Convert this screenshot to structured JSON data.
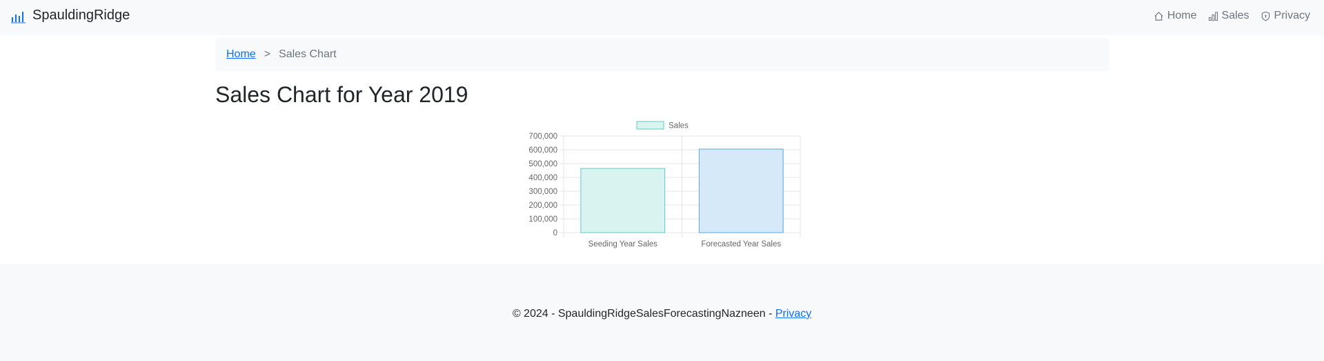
{
  "app": {
    "brand": "SpauldingRidge",
    "brand_icon": "bar-chart-icon"
  },
  "nav": {
    "items": [
      {
        "label": "Home",
        "icon": "home-icon"
      },
      {
        "label": "Sales",
        "icon": "bar-chart-icon"
      },
      {
        "label": "Privacy",
        "icon": "shield-icon"
      }
    ]
  },
  "breadcrumb": {
    "home": "Home",
    "separator": ">",
    "current": "Sales Chart"
  },
  "page": {
    "title": "Sales Chart for Year 2019"
  },
  "chart_data": {
    "type": "bar",
    "categories": [
      "Seeding Year Sales",
      "Forecasted Year Sales"
    ],
    "series": [
      {
        "name": "Sales",
        "values": [
          465000,
          605000
        ]
      }
    ],
    "bar_fill_colors": [
      "#d9f3f1",
      "#d6e9f8"
    ],
    "bar_stroke_colors": [
      "#5fc9c4",
      "#5aa6dd"
    ],
    "legend_fill": "#d9f3f1",
    "legend_stroke": "#5fc9c4",
    "ylim": [
      0,
      700000
    ],
    "yticks": [
      "700,000",
      "600,000",
      "500,000",
      "400,000",
      "300,000",
      "200,000",
      "100,000",
      "0"
    ],
    "legend_position": "top",
    "grid": true
  },
  "footer": {
    "text": "© 2024 - SpauldingRidgeSalesForecastingNazneen - ",
    "link": "Privacy"
  }
}
